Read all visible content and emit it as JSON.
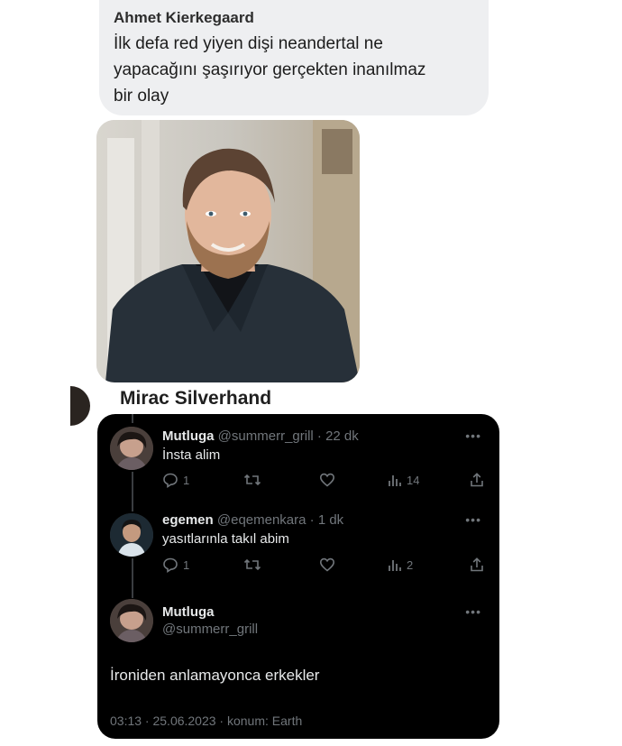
{
  "message": {
    "sender": "Ahmet Kierkegaard",
    "lines": [
      "İlk defa red yiyen dişi neandertal ne",
      "yapacağını şaşırıyor gerçekten inanılmaz",
      "bir olay"
    ]
  },
  "second_sender": {
    "name": "Mirac Silverhand"
  },
  "tweets": [
    {
      "name": "Mutluga",
      "handle": "@summerr_grill",
      "time": "· 22 dk",
      "text": "İnsta alim",
      "replies": "1",
      "views": "14"
    },
    {
      "name": "egemen",
      "handle": "@eqemenkara",
      "time": "· 1 dk",
      "text": "yasıtlarınla takıl abim",
      "replies": "1",
      "views": "2"
    }
  ],
  "main_tweet": {
    "name": "Mutluga",
    "handle": "@summerr_grill",
    "text": "İroniden anlamayonca erkekler",
    "meta": "03:13 · 25.06.2023 · konum: Earth"
  },
  "icons": {
    "more": "more-icon",
    "reply": "reply-icon",
    "retweet": "retweet-icon",
    "like": "like-icon",
    "views": "views-icon",
    "share": "share-icon"
  },
  "colors": {
    "bubble": "#eeeff1",
    "card": "#000000",
    "muted": "#71767b",
    "text_light": "#e7e9ea"
  }
}
